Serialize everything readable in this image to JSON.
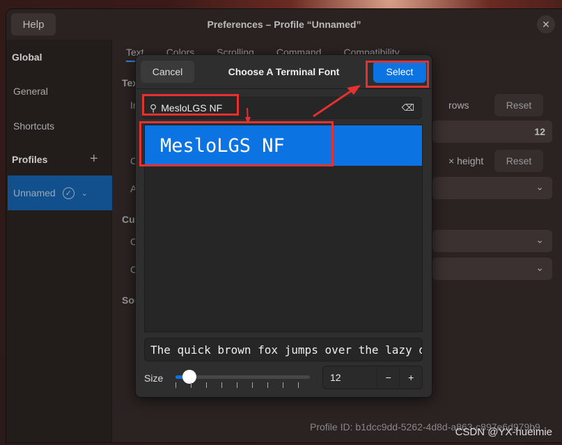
{
  "window": {
    "title": "Preferences – Profile “Unnamed”",
    "help_label": "Help",
    "close_icon": "close-icon"
  },
  "sidebar": {
    "global_heading": "Global",
    "items": [
      {
        "label": "General"
      },
      {
        "label": "Shortcuts"
      }
    ],
    "profiles_heading": "Profiles",
    "add_icon": "plus-icon",
    "profile": {
      "label": "Unnamed",
      "default_icon": "check-circle-icon",
      "menu_icon": "chevron-down-icon"
    }
  },
  "main": {
    "tabs": [
      "Text",
      "Colors",
      "Scrolling",
      "Command",
      "Compatibility"
    ],
    "partial_labels": [
      "Tex",
      "In",
      "C",
      "A",
      "Cur",
      "C",
      "C",
      "Sou"
    ],
    "rows_label": "rows",
    "height_label": "× height",
    "reset_label": "Reset",
    "font_size_value": "12",
    "profile_id_label": "Profile ID:",
    "profile_id": "b1dcc9dd-5262-4d8d-a863-c897e6d979b9"
  },
  "dialog": {
    "title": "Choose A Terminal Font",
    "cancel_label": "Cancel",
    "select_label": "Select",
    "search_value": "MesloLGS NF",
    "fonts": [
      "MesloLGS NF"
    ],
    "preview_text": "The quick brown fox jumps over the lazy dog",
    "size_label": "Size",
    "size_value": "12",
    "size_slider_fraction": 0.1,
    "minus": "−",
    "plus": "+"
  },
  "accent_color": "#0c74e2",
  "annotation_color": "#e5312f",
  "watermark": "CSDN @YX-hueimie"
}
